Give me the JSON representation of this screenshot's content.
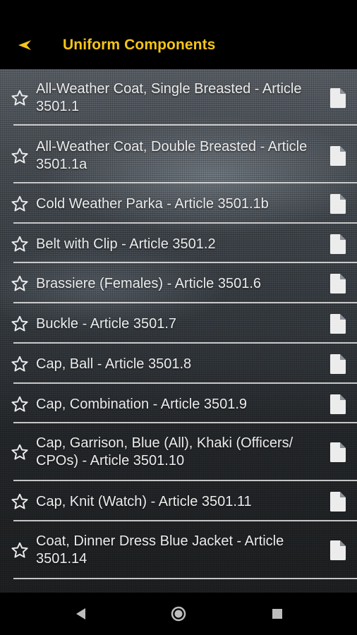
{
  "app": {
    "title": "Uniform Components"
  },
  "colors": {
    "accent": "#f5c518",
    "text": "#ececec",
    "divider": "#e3e3e3"
  },
  "icons": {
    "back": "back-arrow-icon",
    "favorite": "star-outline-icon",
    "document": "document-icon"
  },
  "items": [
    {
      "label": "All-Weather Coat, Single Breasted - Article 3501.1"
    },
    {
      "label": "All-Weather Coat, Double Breasted - Article 3501.1a"
    },
    {
      "label": "Cold Weather Parka - Article 3501.1b"
    },
    {
      "label": "Belt with Clip - Article 3501.2"
    },
    {
      "label": "Brassiere (Females) - Article 3501.6"
    },
    {
      "label": "Buckle - Article 3501.7"
    },
    {
      "label": "Cap, Ball - Article 3501.8"
    },
    {
      "label": "Cap, Combination - Article 3501.9"
    },
    {
      "label": "Cap, Garrison, Blue (All), Khaki (Officers/ CPOs) - Article 3501.10"
    },
    {
      "label": "Cap, Knit (Watch) - Article 3501.11"
    },
    {
      "label": "Coat, Dinner Dress Blue Jacket - Article 3501.14"
    }
  ],
  "navbar": {
    "buttons": [
      "back-nav-icon",
      "home-nav-icon",
      "recents-nav-icon"
    ]
  }
}
